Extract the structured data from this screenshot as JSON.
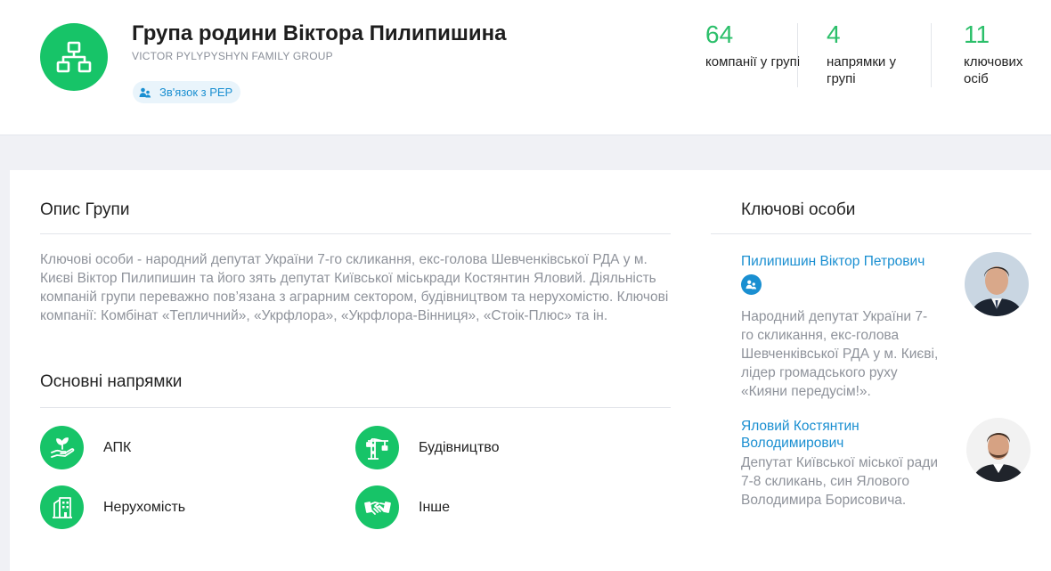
{
  "header": {
    "title": "Група родини Віктора Пилипишина",
    "subtitle": "VICTOR PYLYPYSHYN FAMILY GROUP",
    "pep_link_label": "Зв'язок з PEP",
    "stats": [
      {
        "value": "64",
        "label": "компанії у групі"
      },
      {
        "value": "4",
        "label": "напрямки у групі"
      },
      {
        "value": "11",
        "label": "ключових осіб"
      }
    ]
  },
  "description": {
    "title": "Опис Групи",
    "text": "Ключові особи - народний депутат України 7-го скликання, екс-голова Шевченківської РДА у м. Києві Віктор Пилипишин та його зять депутат Київської міськради Костянтин Яловий. Діяльність компаній групи переважно пов’язана з аграрним сектором, будівництвом та нерухомістю. Ключові компанії: Комбінат «Тепличний», «Укрфлора», «Укрфлора-Вінниця», «Стоік-Плюс» та ін."
  },
  "directions": {
    "title": "Основні напрямки",
    "items": [
      {
        "label": "АПК",
        "icon": "plant-hand-icon"
      },
      {
        "label": "Будівництво",
        "icon": "crane-icon"
      },
      {
        "label": "Нерухомість",
        "icon": "building-icon"
      },
      {
        "label": "Інше",
        "icon": "handshake-icon"
      }
    ]
  },
  "key_persons": {
    "title": "Ключові особи",
    "items": [
      {
        "name": "Пилипишин Віктор Петрович",
        "has_pep_badge": true,
        "description": "Народний депутат України 7-го скликання, екс-голова Шевченківської РДА у м. Києві, лідер громадського руху «Кияни передусім!»."
      },
      {
        "name": "Яловий Костянтин Володимирович",
        "has_pep_badge": false,
        "description": "Депутат Київської міської ради 7-8 скликань, син Ялового Володимира Борисовича."
      }
    ]
  },
  "colors": {
    "accent_green": "#17c468",
    "stat_green": "#2bbf6a",
    "link_blue": "#1a8fd1",
    "muted_text": "#8f939b"
  }
}
